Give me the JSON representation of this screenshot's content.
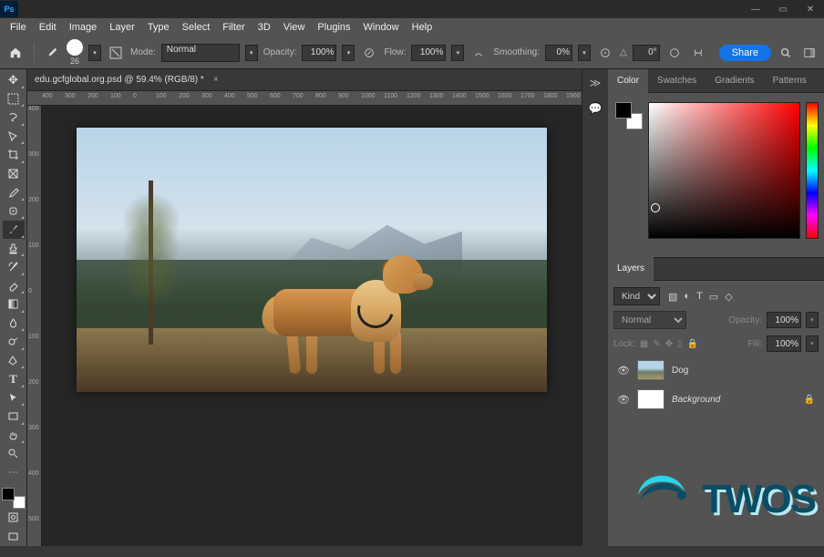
{
  "menu": [
    "File",
    "Edit",
    "Image",
    "Layer",
    "Type",
    "Select",
    "Filter",
    "3D",
    "View",
    "Plugins",
    "Window",
    "Help"
  ],
  "options": {
    "brush_size": "26",
    "mode_label": "Mode:",
    "mode_value": "Normal",
    "opacity_label": "Opacity:",
    "opacity_value": "100%",
    "flow_label": "Flow:",
    "flow_value": "100%",
    "smoothing_label": "Smoothing:",
    "smoothing_value": "0%",
    "angle_value": "0°",
    "share": "Share"
  },
  "doc_tab": "edu.gcfglobal.org.psd @ 59.4% (RGB/8) *",
  "ruler_h": [
    "400",
    "300",
    "200",
    "100",
    "0",
    "100",
    "200",
    "300",
    "400",
    "500",
    "600",
    "700",
    "800",
    "900",
    "1000",
    "1100",
    "1200",
    "1300",
    "1400",
    "1500",
    "1600",
    "1700",
    "1800",
    "1900"
  ],
  "ruler_v": [
    "400",
    "300",
    "200",
    "100",
    "0",
    "100",
    "200",
    "300",
    "400",
    "500"
  ],
  "panels": {
    "color_tabs": [
      "Color",
      "Swatches",
      "Gradients",
      "Patterns"
    ],
    "layers_tab": "Layers",
    "kind_label": "Kind",
    "blend_mode": "Normal",
    "opacity_label": "Opacity:",
    "opacity_value": "100%",
    "lock_label": "Lock:",
    "fill_label": "Fill:",
    "fill_value": "100%",
    "layers": [
      {
        "name": "Dog",
        "thumb": "dog"
      },
      {
        "name": "Background",
        "thumb": "bg",
        "italic": true,
        "locked": true
      }
    ]
  },
  "overlay": {
    "text": "TWOS"
  }
}
